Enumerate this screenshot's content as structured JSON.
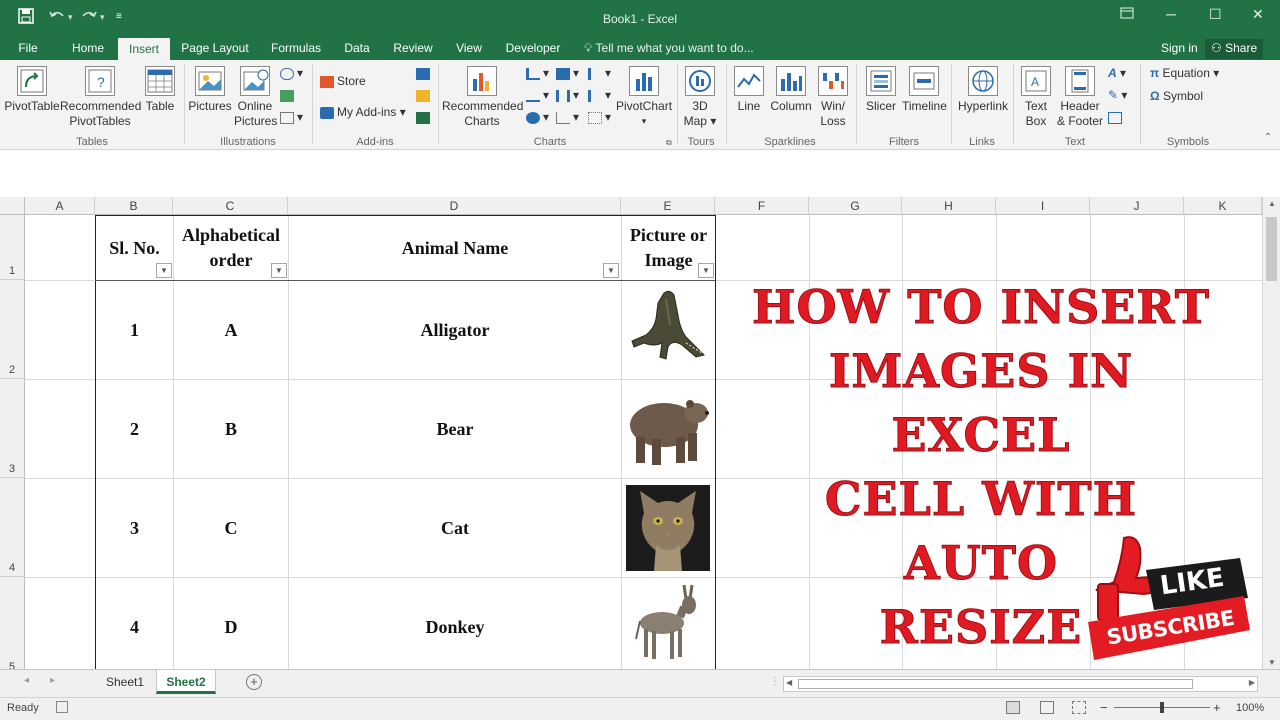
{
  "window": {
    "title": "Book1 - Excel"
  },
  "tabs": [
    {
      "label": "File"
    },
    {
      "label": "Home"
    },
    {
      "label": "Insert"
    },
    {
      "label": "Page Layout"
    },
    {
      "label": "Formulas"
    },
    {
      "label": "Data"
    },
    {
      "label": "Review"
    },
    {
      "label": "View"
    },
    {
      "label": "Developer"
    }
  ],
  "tellme": "Tell me what you want to do...",
  "account": {
    "signin": "Sign in",
    "share": "Share"
  },
  "ribbon": {
    "tables": {
      "pivottable": "PivotTable",
      "recommended_1": "Recommended",
      "recommended_2": "PivotTables",
      "table": "Table",
      "group": "Tables"
    },
    "illustrations": {
      "pictures": "Pictures",
      "online_1": "Online",
      "online_2": "Pictures",
      "group": "Illustrations"
    },
    "addins": {
      "store": "Store",
      "myaddins": "My Add-ins",
      "group": "Add-ins"
    },
    "charts": {
      "recommended_1": "Recommended",
      "recommended_2": "Charts",
      "pivotchart": "PivotChart",
      "group": "Charts"
    },
    "tours": {
      "map_1": "3D",
      "map_2": "Map",
      "group": "Tours"
    },
    "sparklines": {
      "line": "Line",
      "column": "Column",
      "winloss_1": "Win/",
      "winloss_2": "Loss",
      "group": "Sparklines"
    },
    "filters": {
      "slicer": "Slicer",
      "timeline": "Timeline",
      "group": "Filters"
    },
    "links": {
      "hyperlink": "Hyperlink",
      "group": "Links"
    },
    "text": {
      "textbox_1": "Text",
      "textbox_2": "Box",
      "header_1": "Header",
      "header_2": "& Footer",
      "group": "Text"
    },
    "symbols": {
      "equation": "Equation",
      "symbol": "Symbol",
      "group": "Symbols"
    }
  },
  "columns": [
    "A",
    "B",
    "C",
    "D",
    "E",
    "F",
    "G",
    "H",
    "I",
    "J",
    "K"
  ],
  "rows": [
    "1",
    "2",
    "3",
    "4",
    "5"
  ],
  "table": {
    "headers": {
      "slno": "Sl. No.",
      "alpha_1": "Alphabetical",
      "alpha_2": "order",
      "animal": "Animal Name",
      "pic_1": "Picture or",
      "pic_2": "Image"
    },
    "data": [
      {
        "no": "1",
        "letter": "A",
        "name": "Alligator"
      },
      {
        "no": "2",
        "letter": "B",
        "name": "Bear"
      },
      {
        "no": "3",
        "letter": "C",
        "name": "Cat"
      },
      {
        "no": "4",
        "letter": "D",
        "name": "Donkey"
      }
    ]
  },
  "overlay": {
    "line1": "HOW TO INSERT",
    "line2": "IMAGES IN EXCEL",
    "line3": "CELL WITH AUTO",
    "line4": "RESIZE",
    "like": "LIKE",
    "subscribe": "SUBSCRIBE"
  },
  "sheets": [
    {
      "label": "Sheet1"
    },
    {
      "label": "Sheet2"
    }
  ],
  "status": {
    "ready": "Ready",
    "zoom": "100%"
  },
  "colors": {
    "excel_green": "#217346",
    "headline_red": "#e01a22"
  }
}
